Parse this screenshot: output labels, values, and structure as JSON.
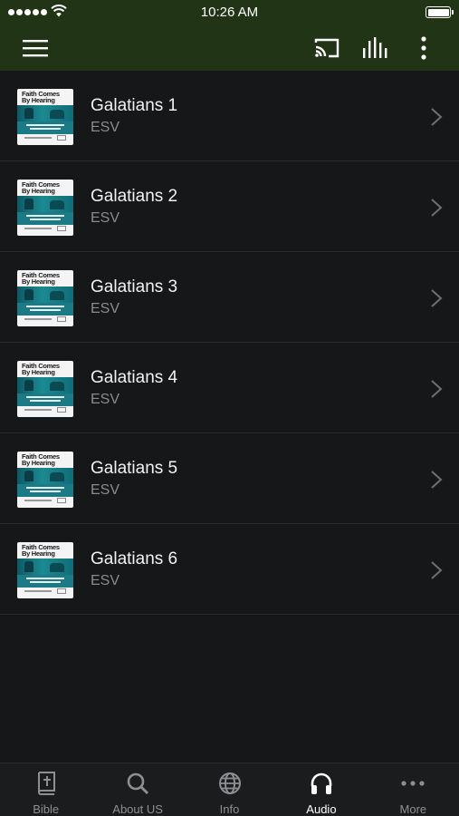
{
  "status_bar": {
    "time": "10:26 AM"
  },
  "app_bar": {
    "icons": [
      "menu-icon",
      "cast-icon",
      "equalizer-icon",
      "more-vert-icon"
    ]
  },
  "thumbnail": {
    "brand_line1": "Faith Comes",
    "brand_line2": "By Hearing"
  },
  "chapters": [
    {
      "title": "Galatians 1",
      "version": "ESV"
    },
    {
      "title": "Galatians 2",
      "version": "ESV"
    },
    {
      "title": "Galatians 3",
      "version": "ESV"
    },
    {
      "title": "Galatians 4",
      "version": "ESV"
    },
    {
      "title": "Galatians 5",
      "version": "ESV"
    },
    {
      "title": "Galatians 6",
      "version": "ESV"
    }
  ],
  "tabs": [
    {
      "label": "Bible",
      "icon": "bible-icon",
      "active": false
    },
    {
      "label": "About US",
      "icon": "search-icon",
      "active": false
    },
    {
      "label": "Info",
      "icon": "globe-icon",
      "active": false
    },
    {
      "label": "Audio",
      "icon": "headphones-icon",
      "active": true
    },
    {
      "label": "More",
      "icon": "more-horiz-icon",
      "active": false
    }
  ],
  "colors": {
    "header": "#223416",
    "background": "#161719",
    "tab_bar": "#1b1c1e",
    "active_tab": "#ffffff",
    "inactive_tab": "#8e8f92"
  }
}
